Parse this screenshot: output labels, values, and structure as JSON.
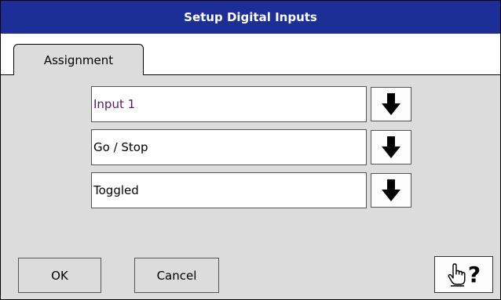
{
  "window": {
    "title": "Setup Digital Inputs"
  },
  "tabs": [
    {
      "label": "Assignment",
      "active": true
    }
  ],
  "fields": [
    {
      "value": "Input 1",
      "text_color": "#5a1a6a",
      "dropdown_icon": "arrow-down-icon"
    },
    {
      "value": "Go / Stop",
      "text_color": "#000000",
      "dropdown_icon": "arrow-down-icon"
    },
    {
      "value": "Toggled",
      "text_color": "#000000",
      "dropdown_icon": "arrow-down-icon"
    }
  ],
  "buttons": {
    "ok_label": "OK",
    "cancel_label": "Cancel",
    "help_icon": "hand-question-icon"
  },
  "colors": {
    "titlebar": "#1c2f98",
    "background": "#dcdcdc"
  }
}
